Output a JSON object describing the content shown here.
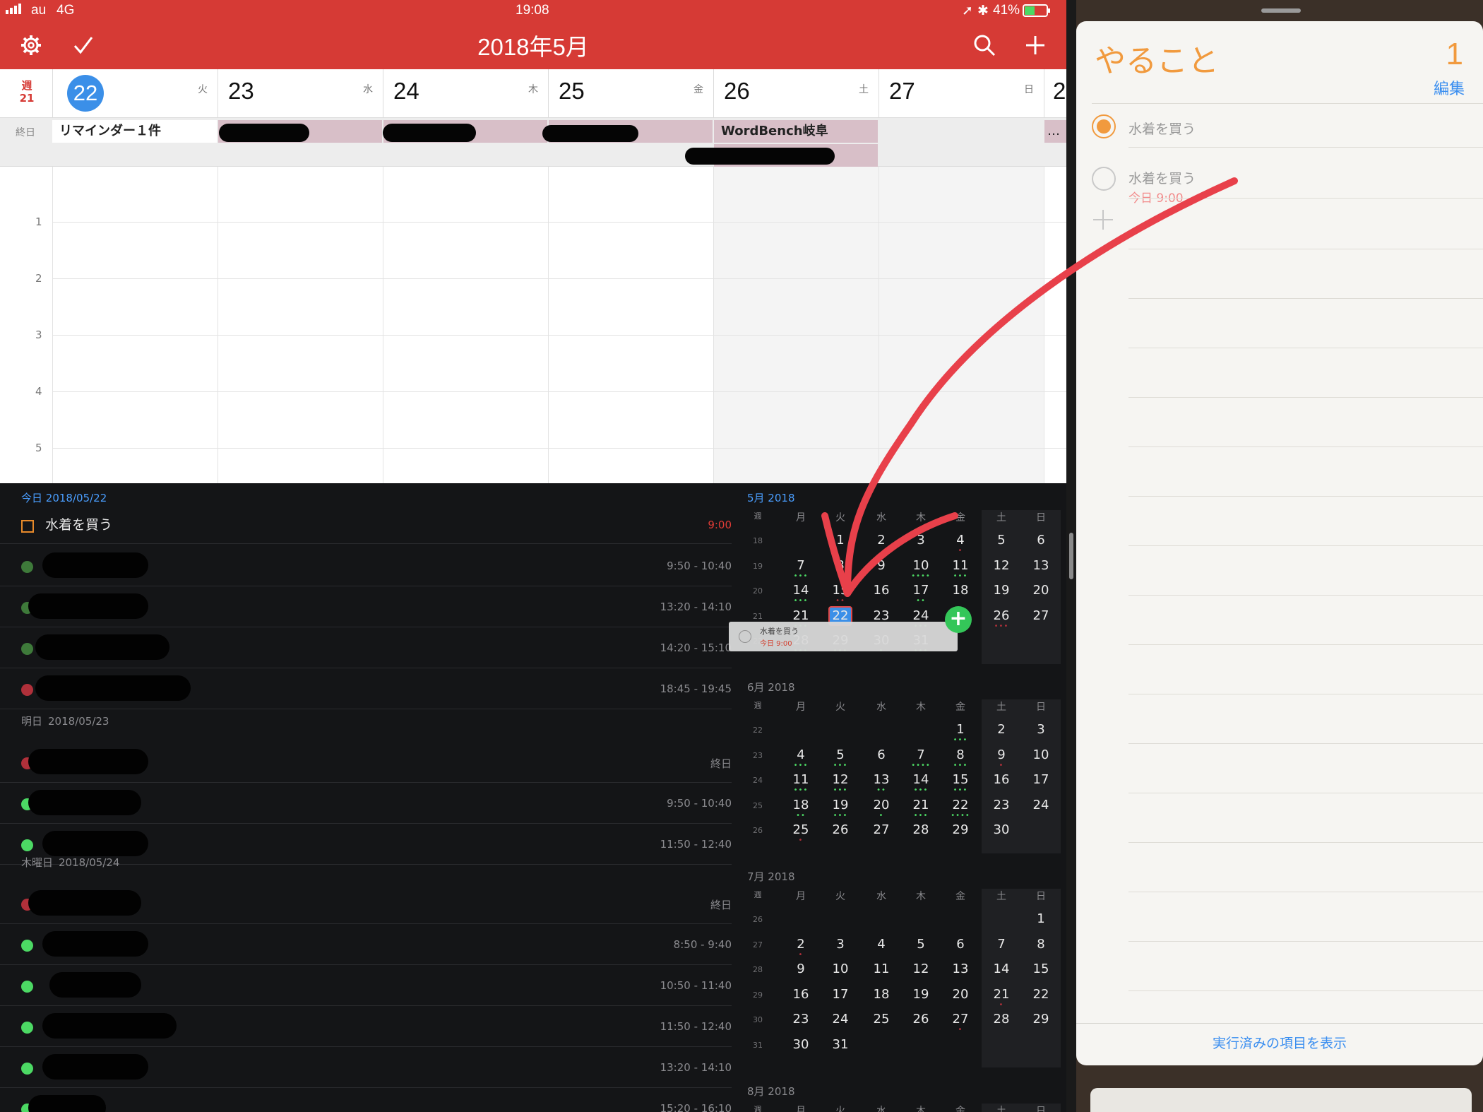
{
  "status": {
    "carrier": "au",
    "network": "4G",
    "time": "19:08",
    "battery": "41%"
  },
  "calendar": {
    "month_title": "2018年5月",
    "week_label_top": "週",
    "week_number": "21",
    "allday_label": "終日",
    "days": [
      {
        "num": "22",
        "wd": "火",
        "today": true
      },
      {
        "num": "23",
        "wd": "水",
        "today": false
      },
      {
        "num": "24",
        "wd": "木",
        "today": false
      },
      {
        "num": "25",
        "wd": "金",
        "today": false
      },
      {
        "num": "26",
        "wd": "土",
        "today": false
      },
      {
        "num": "27",
        "wd": "日",
        "today": false
      },
      {
        "num": "2",
        "wd": "",
        "today": false
      }
    ],
    "allday_events": {
      "reminder": "リマインダー１件",
      "wordbench": "WordBench岐阜",
      "more": "…"
    },
    "hours": [
      "1",
      "2",
      "3",
      "4",
      "5"
    ]
  },
  "agenda": {
    "today_label": "今日",
    "today_date": "2018/05/22",
    "task_title": "水着を買う",
    "task_time": "9:00",
    "today_times": [
      "9:50 - 10:40",
      "13:20 - 14:10",
      "14:20 - 15:10",
      "18:45 - 19:45"
    ],
    "tomorrow_label": "明日",
    "tomorrow_date": "2018/05/23",
    "tomorrow_times": [
      "終日",
      "9:50 - 10:40",
      "11:50 - 12:40"
    ],
    "thu_label": "木曜日",
    "thu_date": "2018/05/24",
    "thu_times": [
      "終日",
      "8:50 - 9:40",
      "10:50 - 11:40",
      "11:50 - 12:40",
      "13:20 - 14:10",
      "15:20 - 16:10"
    ]
  },
  "minical": {
    "weekday_heads": [
      "週",
      "月",
      "火",
      "水",
      "木",
      "金",
      "土",
      "日"
    ],
    "may": {
      "title": "5月 2018",
      "rows": [
        {
          "wk": "18",
          "days": [
            "",
            "1",
            "2",
            "3",
            "4",
            "5",
            "6"
          ]
        },
        {
          "wk": "19",
          "days": [
            "7",
            "8",
            "9",
            "10",
            "11",
            "12",
            "13"
          ]
        },
        {
          "wk": "20",
          "days": [
            "14",
            "15",
            "16",
            "17",
            "18",
            "19",
            "20"
          ]
        },
        {
          "wk": "21",
          "days": [
            "21",
            "22",
            "23",
            "24",
            "25",
            "26",
            "27"
          ]
        },
        {
          "wk": "22",
          "days": [
            "28",
            "29",
            "30",
            "31",
            "",
            "",
            ""
          ]
        }
      ]
    },
    "june": {
      "title": "6月 2018",
      "rows": [
        {
          "wk": "22",
          "days": [
            "",
            "",
            "",
            "",
            "1",
            "2",
            "3"
          ]
        },
        {
          "wk": "23",
          "days": [
            "4",
            "5",
            "6",
            "7",
            "8",
            "9",
            "10"
          ]
        },
        {
          "wk": "24",
          "days": [
            "11",
            "12",
            "13",
            "14",
            "15",
            "16",
            "17"
          ]
        },
        {
          "wk": "25",
          "days": [
            "18",
            "19",
            "20",
            "21",
            "22",
            "23",
            "24"
          ]
        },
        {
          "wk": "26",
          "days": [
            "25",
            "26",
            "27",
            "28",
            "29",
            "30",
            ""
          ]
        }
      ]
    },
    "july": {
      "title": "7月 2018",
      "rows": [
        {
          "wk": "26",
          "days": [
            "",
            "",
            "",
            "",
            "",
            "",
            "1"
          ]
        },
        {
          "wk": "27",
          "days": [
            "2",
            "3",
            "4",
            "5",
            "6",
            "7",
            "8"
          ]
        },
        {
          "wk": "28",
          "days": [
            "9",
            "10",
            "11",
            "12",
            "13",
            "14",
            "15"
          ]
        },
        {
          "wk": "29",
          "days": [
            "16",
            "17",
            "18",
            "19",
            "20",
            "21",
            "22"
          ]
        },
        {
          "wk": "30",
          "days": [
            "23",
            "24",
            "25",
            "26",
            "27",
            "28",
            "29"
          ]
        },
        {
          "wk": "31",
          "days": [
            "30",
            "31",
            "",
            "",
            "",
            "",
            ""
          ]
        }
      ]
    },
    "august": {
      "title": "8月 2018"
    },
    "drag_card": {
      "title": "水着を買う",
      "sub": "今日 9:00"
    }
  },
  "reminders": {
    "list_title": "やること",
    "count": "1",
    "edit": "編集",
    "items": [
      {
        "text": "水着を買う",
        "sub": "",
        "checked": true
      },
      {
        "text": "水着を買う",
        "sub": "今日 9:00",
        "checked": false
      }
    ],
    "footer": "実行済みの項目を表示"
  },
  "colors": {
    "accent_red": "#d63a35",
    "today_blue": "#3b8fe8",
    "reminder_orange": "#f19a3e",
    "dot_green": "#4cd964",
    "dot_red": "#b0303a"
  }
}
